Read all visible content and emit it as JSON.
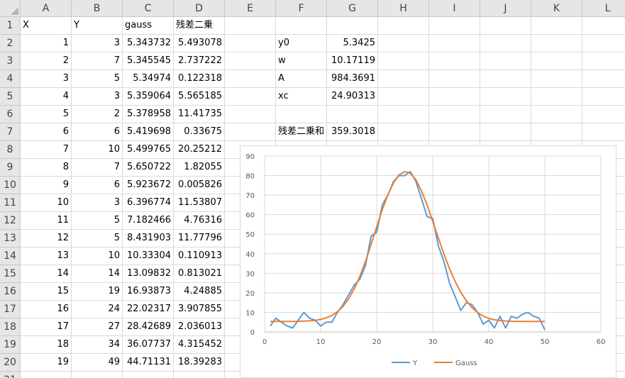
{
  "columns": [
    "A",
    "B",
    "C",
    "D",
    "E",
    "F",
    "G",
    "H",
    "I",
    "J",
    "K",
    "L"
  ],
  "rows": [
    {
      "n": "1",
      "A": "X",
      "B": "Y",
      "C": "gauss",
      "D": "残差二乗",
      "F": "",
      "G": ""
    },
    {
      "n": "2",
      "A": "1",
      "B": "3",
      "C": "5.343732",
      "D": "5.493078",
      "F": "y0",
      "G": "5.3425"
    },
    {
      "n": "3",
      "A": "2",
      "B": "7",
      "C": "5.345545",
      "D": "2.737222",
      "F": "w",
      "G": "10.17119"
    },
    {
      "n": "4",
      "A": "3",
      "B": "5",
      "C": "5.34974",
      "D": "0.122318",
      "F": "A",
      "G": "984.3691"
    },
    {
      "n": "5",
      "A": "4",
      "B": "3",
      "C": "5.359064",
      "D": "5.565185",
      "F": "xc",
      "G": "24.90313"
    },
    {
      "n": "6",
      "A": "5",
      "B": "2",
      "C": "5.378958",
      "D": "11.41735",
      "F": "",
      "G": ""
    },
    {
      "n": "7",
      "A": "6",
      "B": "6",
      "C": "5.419698",
      "D": "0.33675",
      "F": "残差二乗和",
      "G": "359.3018"
    },
    {
      "n": "8",
      "A": "7",
      "B": "10",
      "C": "5.499765",
      "D": "20.25212"
    },
    {
      "n": "9",
      "A": "8",
      "B": "7",
      "C": "5.650722",
      "D": "1.82055"
    },
    {
      "n": "10",
      "A": "9",
      "B": "6",
      "C": "5.923672",
      "D": "0.005826"
    },
    {
      "n": "11",
      "A": "10",
      "B": "3",
      "C": "6.396774",
      "D": "11.53807"
    },
    {
      "n": "12",
      "A": "11",
      "B": "5",
      "C": "7.182466",
      "D": "4.76316"
    },
    {
      "n": "13",
      "A": "12",
      "B": "5",
      "C": "8.431903",
      "D": "11.77796"
    },
    {
      "n": "14",
      "A": "13",
      "B": "10",
      "C": "10.33304",
      "D": "0.110913"
    },
    {
      "n": "15",
      "A": "14",
      "B": "14",
      "C": "13.09832",
      "D": "0.813021"
    },
    {
      "n": "16",
      "A": "15",
      "B": "19",
      "C": "16.93873",
      "D": "4.24885"
    },
    {
      "n": "17",
      "A": "16",
      "B": "24",
      "C": "22.02317",
      "D": "3.907855"
    },
    {
      "n": "18",
      "A": "17",
      "B": "27",
      "C": "28.42689",
      "D": "2.036013"
    },
    {
      "n": "19",
      "A": "18",
      "B": "34",
      "C": "36.07737",
      "D": "4.315452"
    },
    {
      "n": "20",
      "A": "19",
      "B": "49",
      "C": "44.71131",
      "D": "18.39283"
    },
    {
      "n": "21",
      "A": "",
      "B": "",
      "C": "",
      "D": ""
    }
  ],
  "chart_data": {
    "type": "line",
    "title": "",
    "xlabel": "",
    "ylabel": "",
    "xlim": [
      0,
      60
    ],
    "ylim": [
      0,
      90
    ],
    "x_ticks": [
      "0",
      "10",
      "20",
      "30",
      "40",
      "50",
      "60"
    ],
    "y_ticks": [
      "0",
      "10",
      "20",
      "30",
      "40",
      "50",
      "60",
      "70",
      "80",
      "90"
    ],
    "grid": true,
    "legend": "bottom",
    "series": [
      {
        "name": "Y",
        "color": "#5b9bd5",
        "x": [
          1,
          2,
          3,
          4,
          5,
          6,
          7,
          8,
          9,
          10,
          11,
          12,
          13,
          14,
          15,
          16,
          17,
          18,
          19,
          20,
          21,
          22,
          23,
          24,
          25,
          26,
          27,
          28,
          29,
          30,
          31,
          32,
          33,
          34,
          35,
          36,
          37,
          38,
          39,
          40,
          41,
          42,
          43,
          44,
          45,
          46,
          47,
          48,
          49,
          50
        ],
        "y": [
          3,
          7,
          5,
          3,
          2,
          6,
          10,
          7,
          6,
          3,
          5,
          5,
          10,
          14,
          19,
          24,
          27,
          34,
          49,
          51,
          65,
          70,
          77,
          80,
          80,
          82,
          77,
          68,
          59,
          58,
          44,
          36,
          25,
          18,
          11,
          15,
          14,
          10,
          4,
          6,
          2,
          8,
          2,
          8,
          7,
          9,
          10,
          8,
          7,
          1
        ]
      },
      {
        "name": "Gauss",
        "color": "#ed7d31",
        "x": [
          1,
          2,
          3,
          4,
          5,
          6,
          7,
          8,
          9,
          10,
          11,
          12,
          13,
          14,
          15,
          16,
          17,
          18,
          19,
          20,
          21,
          22,
          23,
          24,
          25,
          26,
          27,
          28,
          29,
          30,
          31,
          32,
          33,
          34,
          35,
          36,
          37,
          38,
          39,
          40,
          41,
          42,
          43,
          44,
          45,
          46,
          47,
          48,
          49,
          50
        ],
        "y": [
          5.34,
          5.35,
          5.35,
          5.36,
          5.38,
          5.42,
          5.5,
          5.65,
          5.92,
          6.4,
          7.18,
          8.43,
          10.33,
          13.1,
          16.94,
          22.02,
          28.43,
          36.08,
          44.71,
          53.8,
          62.6,
          70.2,
          76.3,
          80.4,
          82.0,
          81.2,
          77.8,
          72.1,
          64.8,
          56.5,
          48.0,
          39.8,
          32.3,
          25.8,
          20.3,
          15.9,
          12.5,
          9.9,
          8.1,
          6.9,
          6.2,
          5.8,
          5.6,
          5.45,
          5.4,
          5.37,
          5.36,
          5.35,
          5.35,
          5.34
        ]
      }
    ]
  }
}
